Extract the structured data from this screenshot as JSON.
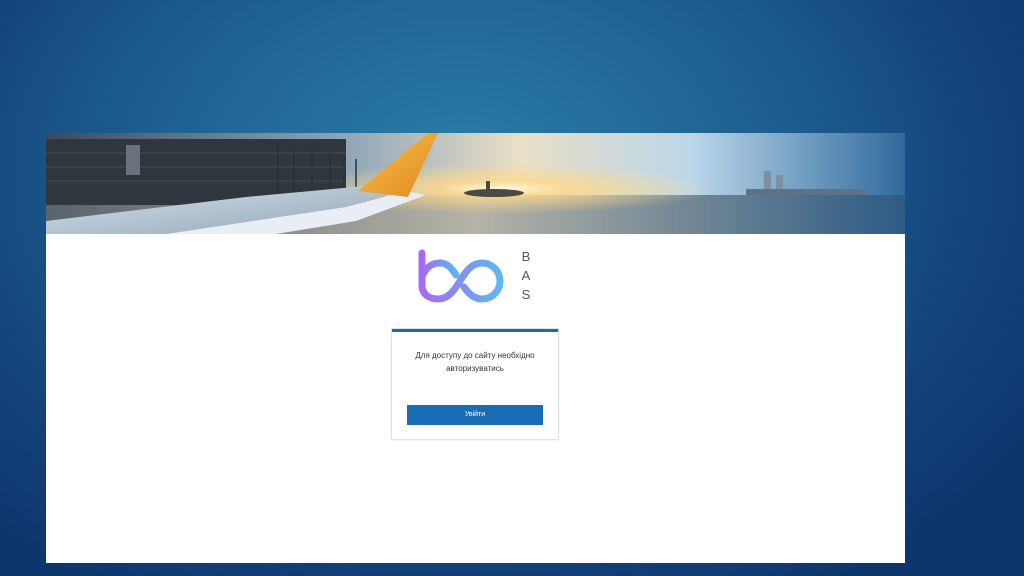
{
  "logo": {
    "letters": [
      "B",
      "A",
      "S"
    ],
    "gradient_start": "#a46cf2",
    "gradient_end": "#5fb6f0"
  },
  "login": {
    "message": "Для доступу до сайту необхідно авторизуватись",
    "button_label": "Увійти"
  },
  "colors": {
    "accent": "#1a6db5",
    "background_dark": "#0e356c",
    "background_light": "#2b7ea8"
  },
  "icons": [
    "airport-runway-banner",
    "bas-logo-icon"
  ]
}
